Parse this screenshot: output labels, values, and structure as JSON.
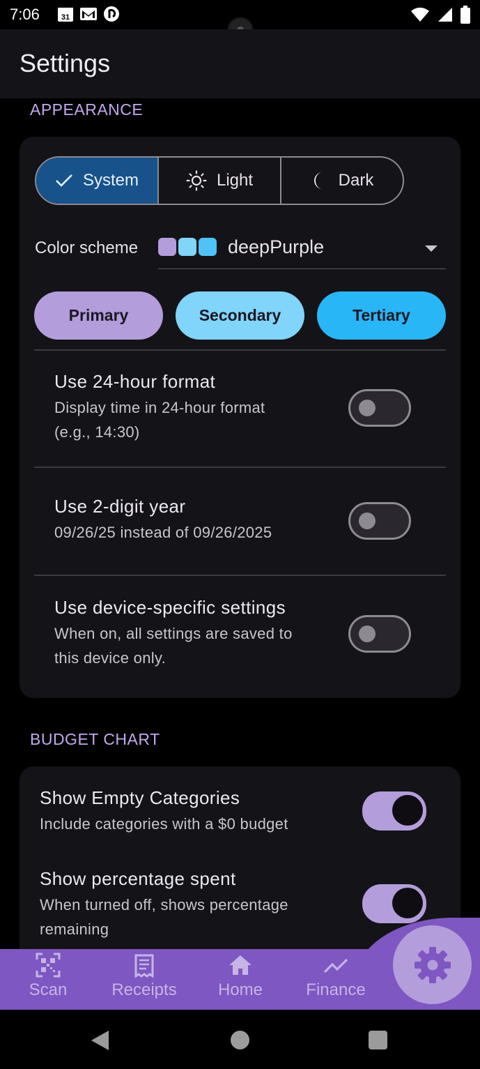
{
  "status_bar": {
    "time": "7:06",
    "left_icons": [
      "calendar-icon",
      "gmail-icon",
      "pocket-casts-icon"
    ],
    "calendar_day": "31",
    "right_icons": [
      "wifi-icon",
      "signal-icon",
      "battery-icon"
    ]
  },
  "app_bar": {
    "title": "Settings"
  },
  "appearance": {
    "header": "APPEARANCE",
    "theme_options": [
      {
        "label": "System",
        "icon": "check-icon",
        "selected": true
      },
      {
        "label": "Light",
        "icon": "sun-icon",
        "selected": false
      },
      {
        "label": "Dark",
        "icon": "moon-icon",
        "selected": false
      }
    ],
    "color_scheme": {
      "label": "Color scheme",
      "value": "deepPurple",
      "swatches": [
        "#b39ddb",
        "#81d4fa",
        "#4fc3f7"
      ]
    },
    "chips": [
      {
        "label": "Primary",
        "color": "#b39ddb"
      },
      {
        "label": "Secondary",
        "color": "#81d4fa"
      },
      {
        "label": "Tertiary",
        "color": "#29b6f6"
      }
    ],
    "settings": [
      {
        "title": "Use 24-hour format",
        "subtitle_lines": [
          "Display time in 24-hour format",
          "(e.g., 14:30)"
        ],
        "enabled": false
      },
      {
        "title": "Use 2-digit year",
        "subtitle_lines": [
          "09/26/25 instead of 09/26/2025"
        ],
        "enabled": false
      },
      {
        "title": "Use device-specific settings",
        "subtitle_lines": [
          "When on, all settings are saved to",
          "this device only."
        ],
        "enabled": false
      }
    ]
  },
  "budget_chart": {
    "header": "BUDGET CHART",
    "settings": [
      {
        "title": "Show Empty Categories",
        "subtitle_lines": [
          "Include categories with a $0 budget"
        ],
        "enabled": true
      },
      {
        "title": "Show percentage spent",
        "subtitle_lines": [
          "When turned off, shows percentage",
          "remaining"
        ],
        "enabled": true
      }
    ]
  },
  "bottom_nav": {
    "items": [
      {
        "label": "Scan",
        "icon": "qr-code-icon"
      },
      {
        "label": "Receipts",
        "icon": "receipt-icon"
      },
      {
        "label": "Home",
        "icon": "home-icon"
      },
      {
        "label": "Finance",
        "icon": "trending-up-icon"
      }
    ],
    "fab_icon": "gear-icon",
    "colors": {
      "bar": "#7e57c2",
      "fab": "#b39ddb",
      "fab_icon": "#7e57c2"
    }
  },
  "system_nav": {
    "icons": [
      "back-icon",
      "home-circle-icon",
      "recents-icon"
    ]
  }
}
